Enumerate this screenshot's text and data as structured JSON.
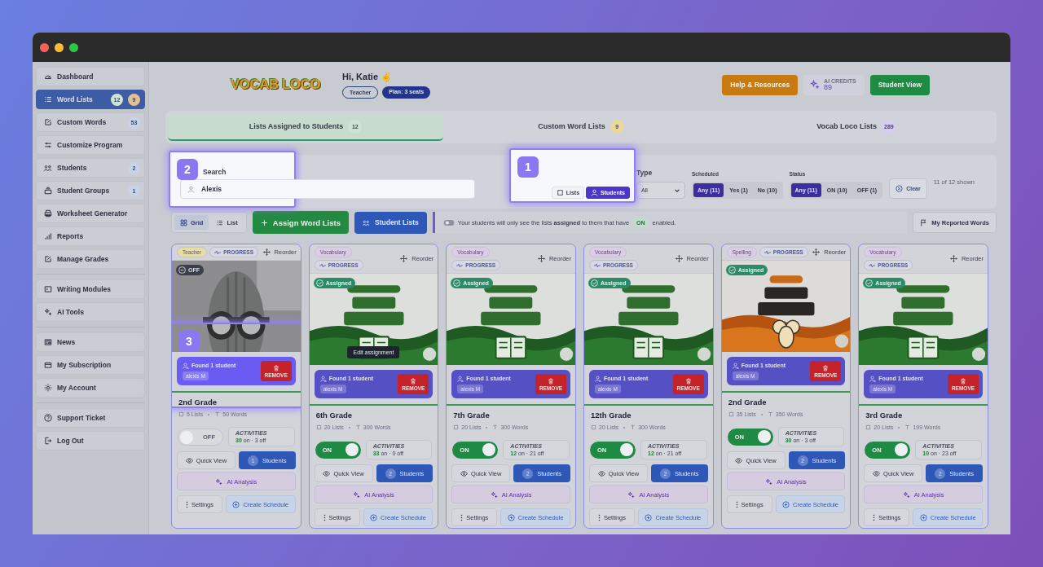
{
  "sidebar": {
    "groups": [
      {
        "items": [
          {
            "label": "Dashboard",
            "selected": false
          },
          {
            "label": "Word Lists",
            "selected": true,
            "badges": [
              {
                "text": "12",
                "color": "#cfe6d2"
              },
              {
                "text": "9",
                "color": "#e6bf8e"
              }
            ]
          },
          {
            "label": "Custom Words",
            "selected": false,
            "badges": [
              {
                "text": "53",
                "color": "#c6d3e8"
              }
            ]
          },
          {
            "label": "Customize Program",
            "selected": false
          },
          {
            "label": "Students",
            "selected": false,
            "badges": [
              {
                "text": "2",
                "color": "#c6d3e8"
              }
            ]
          },
          {
            "label": "Student Groups",
            "selected": false,
            "badges": [
              {
                "text": "1",
                "color": "#c6d3e8"
              }
            ]
          },
          {
            "label": "Worksheet Generator",
            "selected": false
          },
          {
            "label": "Reports",
            "selected": false
          },
          {
            "label": "Manage Grades",
            "selected": false
          }
        ]
      },
      {
        "items": [
          {
            "label": "Writing Modules",
            "selected": false
          },
          {
            "label": "AI Tools",
            "selected": false
          }
        ]
      },
      {
        "items": [
          {
            "label": "News",
            "selected": false
          },
          {
            "label": "My Subscription",
            "selected": false
          },
          {
            "label": "My Account",
            "selected": false
          }
        ]
      },
      {
        "items": [
          {
            "label": "Support Ticket",
            "selected": false
          },
          {
            "label": "Log Out",
            "selected": false
          }
        ]
      }
    ]
  },
  "header": {
    "logo": "VOCAB LOCO",
    "greeting": "Hi, Katie ✌",
    "role": "Teacher",
    "plan": "Plan: 3 seats",
    "help": "Help & Resources",
    "credits_label": "AI CREDITS",
    "credits": "89",
    "student_view": "Student View"
  },
  "tabs": [
    {
      "label": "Lists Assigned to Students",
      "count": "12",
      "color": "#cde3d3",
      "selected": true
    },
    {
      "label": "Custom Word Lists",
      "count": "9",
      "color": "#e8d89a",
      "selected": false
    },
    {
      "label": "Vocab Loco Lists",
      "count": "289",
      "color": "#d6cdf0",
      "selected": false
    }
  ],
  "filters": {
    "search": {
      "label": "Search",
      "value": "Alexis",
      "tour_step": "2"
    },
    "view_toggle": {
      "tour_step": "1",
      "options": [
        {
          "label": "Lists",
          "selected": false
        },
        {
          "label": "Students",
          "selected": true
        }
      ]
    },
    "type": {
      "label": "Type",
      "value": "All"
    },
    "scheduled": {
      "label": "Scheduled",
      "options": [
        {
          "label": "Any (11)",
          "selected": true
        },
        {
          "label": "Yes (1)",
          "selected": false
        },
        {
          "label": "No (10)",
          "selected": false
        }
      ]
    },
    "status": {
      "label": "Status",
      "options": [
        {
          "label": "Any (11)",
          "selected": true
        },
        {
          "label": "ON (10)",
          "selected": false
        },
        {
          "label": "OFF (1)",
          "selected": false
        }
      ]
    },
    "clear": "Clear",
    "shown": "11 of 12 shown"
  },
  "toolbar": {
    "view_options": [
      {
        "label": "Grid",
        "selected": true
      },
      {
        "label": "List",
        "selected": false
      }
    ],
    "assign": "Assign Word Lists",
    "student_lists": "Student Lists",
    "note_before": "Your students will only see the lists **assigned** to them that have",
    "note_pill": "ON",
    "note_after": "enabled.",
    "reported": "My Reported Words"
  },
  "cards": [
    {
      "category": {
        "label": "Teacher",
        "color": "#e6dca6"
      },
      "progress": "PROGRESS",
      "reorder": "Reorder",
      "badge": {
        "kind": "off",
        "label": "OFF"
      },
      "found": {
        "label": "Found 1 student",
        "student": "alexis M",
        "action": "REMOVE",
        "tour_step": "3"
      },
      "title": "2nd Grade",
      "lists": "5 Lists",
      "words": "50 Words",
      "toggle": {
        "on": false,
        "label": "OFF"
      },
      "activities": {
        "label": "ACTIVITIES",
        "on_count": "30",
        "rest": "on · 3 off"
      },
      "quick_view": "Quick View",
      "students": {
        "count": "1",
        "label": "Students"
      },
      "ai": "AI Analysis",
      "settings": "Settings",
      "schedule": "Create Schedule"
    },
    {
      "category": {
        "label": "Vocabulary",
        "color": "#dccde6"
      },
      "progress": "PROGRESS",
      "reorder": "Reorder",
      "cover": {
        "kind": "book"
      },
      "badge": {
        "kind": "assigned",
        "label": "Assigned"
      },
      "tooltip": "Edit assignment",
      "found": {
        "label": "Found 1 student",
        "student": "alexis M",
        "action": "REMOVE"
      },
      "title": "6th Grade",
      "lists": "20 Lists",
      "words": "300 Words",
      "toggle": {
        "on": true,
        "label": "ON"
      },
      "activities": {
        "label": "ACTIVITIES",
        "on_count": "33",
        "rest": "on · 0 off"
      },
      "quick_view": "Quick View",
      "students": {
        "count": "2",
        "label": "Students"
      },
      "ai": "AI Analysis",
      "settings": "Settings",
      "schedule": "Create Schedule"
    },
    {
      "category": {
        "label": "Vocabulary",
        "color": "#dccde6"
      },
      "progress": "PROGRESS",
      "reorder": "Reorder",
      "cover": {
        "kind": "book"
      },
      "badge": {
        "kind": "assigned",
        "label": "Assigned"
      },
      "found": {
        "label": "Found 1 student",
        "student": "alexis M",
        "action": "REMOVE"
      },
      "title": "7th Grade",
      "lists": "20 Lists",
      "words": "300 Words",
      "toggle": {
        "on": true,
        "label": "ON"
      },
      "activities": {
        "label": "ACTIVITIES",
        "on_count": "12",
        "rest": "on · 21 off"
      },
      "quick_view": "Quick View",
      "students": {
        "count": "2",
        "label": "Students"
      },
      "ai": "AI Analysis",
      "settings": "Settings",
      "schedule": "Create Schedule"
    },
    {
      "category": {
        "label": "Vocabulary",
        "color": "#dccde6"
      },
      "progress": "PROGRESS",
      "reorder": "Reorder",
      "cover": {
        "kind": "book"
      },
      "badge": {
        "kind": "assigned",
        "label": "Assigned"
      },
      "found": {
        "label": "Found 1 student",
        "student": "alexis M",
        "action": "REMOVE"
      },
      "title": "12th Grade",
      "lists": "20 Lists",
      "words": "300 Words",
      "toggle": {
        "on": true,
        "label": "ON"
      },
      "activities": {
        "label": "ACTIVITIES",
        "on_count": "12",
        "rest": "on · 21 off"
      },
      "quick_view": "Quick View",
      "students": {
        "count": "2",
        "label": "Students"
      },
      "ai": "AI Analysis",
      "settings": "Settings",
      "schedule": "Create Schedule"
    },
    {
      "category": {
        "label": "Spelling",
        "color": "#dccde6"
      },
      "progress": "PROGRESS",
      "reorder": "Reorder",
      "cover": {
        "kind": "bee"
      },
      "badge": {
        "kind": "assigned",
        "label": "Assigned"
      },
      "found": {
        "label": "Found 1 student",
        "student": "alexis M",
        "action": "REMOVE"
      },
      "title": "2nd Grade",
      "lists": "35 Lists",
      "words": "350 Words",
      "toggle": {
        "on": true,
        "label": "ON"
      },
      "activities": {
        "label": "ACTIVITIES",
        "on_count": "30",
        "rest": "on · 3 off"
      },
      "quick_view": "Quick View",
      "students": {
        "count": "2",
        "label": "Students"
      },
      "ai": "AI Analysis",
      "settings": "Settings",
      "schedule": "Create Schedule"
    },
    {
      "category": {
        "label": "Vocabulary",
        "color": "#dccde6"
      },
      "progress": "PROGRESS",
      "reorder": "Reorder",
      "cover": {
        "kind": "book"
      },
      "badge": {
        "kind": "assigned",
        "label": "Assigned"
      },
      "found": {
        "label": "Found 1 student",
        "student": "alexis M",
        "action": "REMOVE"
      },
      "title": "3rd Grade",
      "lists": "20 Lists",
      "words": "199 Words",
      "toggle": {
        "on": true,
        "label": "ON"
      },
      "activities": {
        "label": "ACTIVITIES",
        "on_count": "10",
        "rest": "on · 23 off"
      },
      "quick_view": "Quick View",
      "students": {
        "count": "2",
        "label": "Students"
      },
      "ai": "AI Analysis",
      "settings": "Settings",
      "schedule": "Create Schedule"
    }
  ]
}
